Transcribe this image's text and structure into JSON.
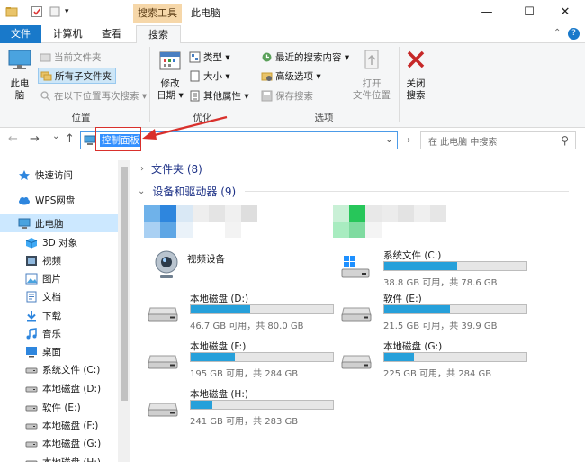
{
  "titlebar": {
    "context_tab": "搜索工具",
    "title": "此电脑",
    "minimize": "—",
    "maximize": "☐",
    "close": "✕"
  },
  "tabs": {
    "file": "文件",
    "computer": "计算机",
    "view": "查看",
    "search": "搜索"
  },
  "ribbon": {
    "location": {
      "this_pc_line1": "此电",
      "this_pc_line2": "脑",
      "current_folder": "当前文件夹",
      "all_subfolders": "所有子文件夹",
      "search_again": "在以下位置再次搜索 ▾",
      "title": "位置"
    },
    "refine": {
      "modified_line1": "修改",
      "modified_line2": "日期 ▾",
      "kind": "类型 ▾",
      "size": "大小 ▾",
      "other_props": "其他属性 ▾",
      "title": "优化"
    },
    "options": {
      "recent": "最近的搜索内容 ▾",
      "advanced": "高级选项 ▾",
      "save": "保存搜索",
      "open_line1": "打开",
      "open_line2": "文件位置",
      "title": "选项"
    },
    "close_line1": "关闭",
    "close_line2": "搜索"
  },
  "nav": {
    "back": "←",
    "forward": "→",
    "recent": "⌄",
    "up": "↑",
    "address_value": "控制面板",
    "address_dropdown": "⌄",
    "go": "→",
    "search_placeholder": "在 此电脑 中搜索",
    "search_icon": "⚲"
  },
  "left_pane": [
    {
      "label": "快速访问",
      "icon": "star-icon"
    },
    {
      "label": "WPS网盘",
      "icon": "cloud-icon"
    },
    {
      "label": "此电脑",
      "icon": "computer-icon"
    },
    {
      "label": "3D 对象",
      "icon": "cube-icon"
    },
    {
      "label": "视频",
      "icon": "video-icon"
    },
    {
      "label": "图片",
      "icon": "picture-icon"
    },
    {
      "label": "文档",
      "icon": "document-icon"
    },
    {
      "label": "下载",
      "icon": "download-icon"
    },
    {
      "label": "音乐",
      "icon": "music-icon"
    },
    {
      "label": "桌面",
      "icon": "desktop-icon"
    },
    {
      "label": "系统文件 (C:)",
      "icon": "drive-icon"
    },
    {
      "label": "本地磁盘 (D:)",
      "icon": "drive-icon"
    },
    {
      "label": "软件 (E:)",
      "icon": "drive-icon"
    },
    {
      "label": "本地磁盘 (F:)",
      "icon": "drive-icon"
    },
    {
      "label": "本地磁盘 (G:)",
      "icon": "drive-icon"
    },
    {
      "label": "本地磁盘 (H:)",
      "icon": "drive-icon"
    }
  ],
  "main": {
    "folders_head": "文件夹 (8)",
    "devices_head": "设备和驱动器 (9)",
    "camera": "视频设备",
    "drives": [
      {
        "name": "系统文件 (C:)",
        "info": "38.8 GB 可用，共 78.6 GB",
        "used": 0.51,
        "system": true
      },
      {
        "name": "本地磁盘 (D:)",
        "info": "46.7 GB 可用，共 80.0 GB",
        "used": 0.42
      },
      {
        "name": "软件 (E:)",
        "info": "21.5 GB 可用，共 39.9 GB",
        "used": 0.46
      },
      {
        "name": "本地磁盘 (F:)",
        "info": "195 GB 可用，共 284 GB",
        "used": 0.31
      },
      {
        "name": "本地磁盘 (G:)",
        "info": "225 GB 可用，共 284 GB",
        "used": 0.21
      },
      {
        "name": "本地磁盘 (H:)",
        "info": "241 GB 可用，共 283 GB",
        "used": 0.15
      }
    ]
  },
  "colors": {
    "accent": "#1979ca",
    "bar_fill": "#26a0da",
    "annotation": "#d9302c"
  }
}
